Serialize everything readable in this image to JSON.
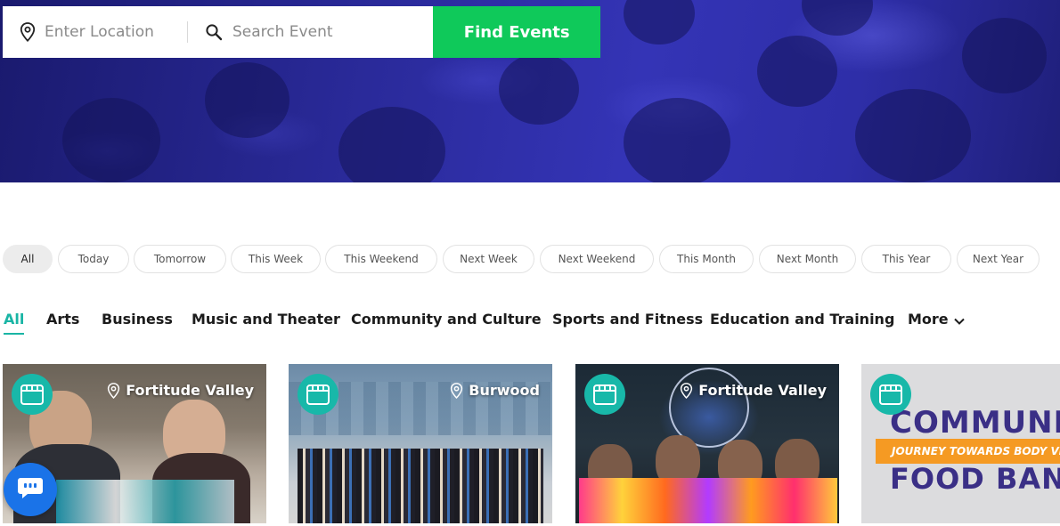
{
  "search": {
    "location_placeholder": "Enter Location",
    "event_placeholder": "Search Event",
    "button_label": "Find Events"
  },
  "date_filters": [
    {
      "label": "All",
      "active": true
    },
    {
      "label": "Today"
    },
    {
      "label": "Tomorrow"
    },
    {
      "label": "This Week"
    },
    {
      "label": "This Weekend"
    },
    {
      "label": "Next Week"
    },
    {
      "label": "Next Weekend"
    },
    {
      "label": "This Month"
    },
    {
      "label": "Next Month"
    },
    {
      "label": "This Year"
    },
    {
      "label": "Next Year"
    }
  ],
  "categories": [
    {
      "label": "All",
      "active": true
    },
    {
      "label": "Arts"
    },
    {
      "label": "Business"
    },
    {
      "label": "Music and Theater"
    },
    {
      "label": "Community and Culture"
    },
    {
      "label": "Sports and Fitness"
    },
    {
      "label": "Education and Training"
    },
    {
      "label": "More"
    }
  ],
  "events": [
    {
      "location": "Fortitude Valley"
    },
    {
      "location": "Burwood"
    },
    {
      "location": "Fortitude Valley"
    },
    {
      "location": "",
      "image_text": {
        "title": "COMMUNIT",
        "ribbon": "JOURNEY TOWARDS BODY VIT",
        "subtitle": "FOOD BAN"
      }
    }
  ],
  "colors": {
    "accent": "#19b5a5",
    "find_button": "#0fc95a",
    "hero": "#2a2a9a",
    "chat": "#1a73e8"
  },
  "icons": {
    "location": "map-pin-icon",
    "search": "magnifier-icon",
    "badge": "calendar-icon",
    "more": "chevron-down-icon",
    "chat": "chat-bubble-icon"
  }
}
